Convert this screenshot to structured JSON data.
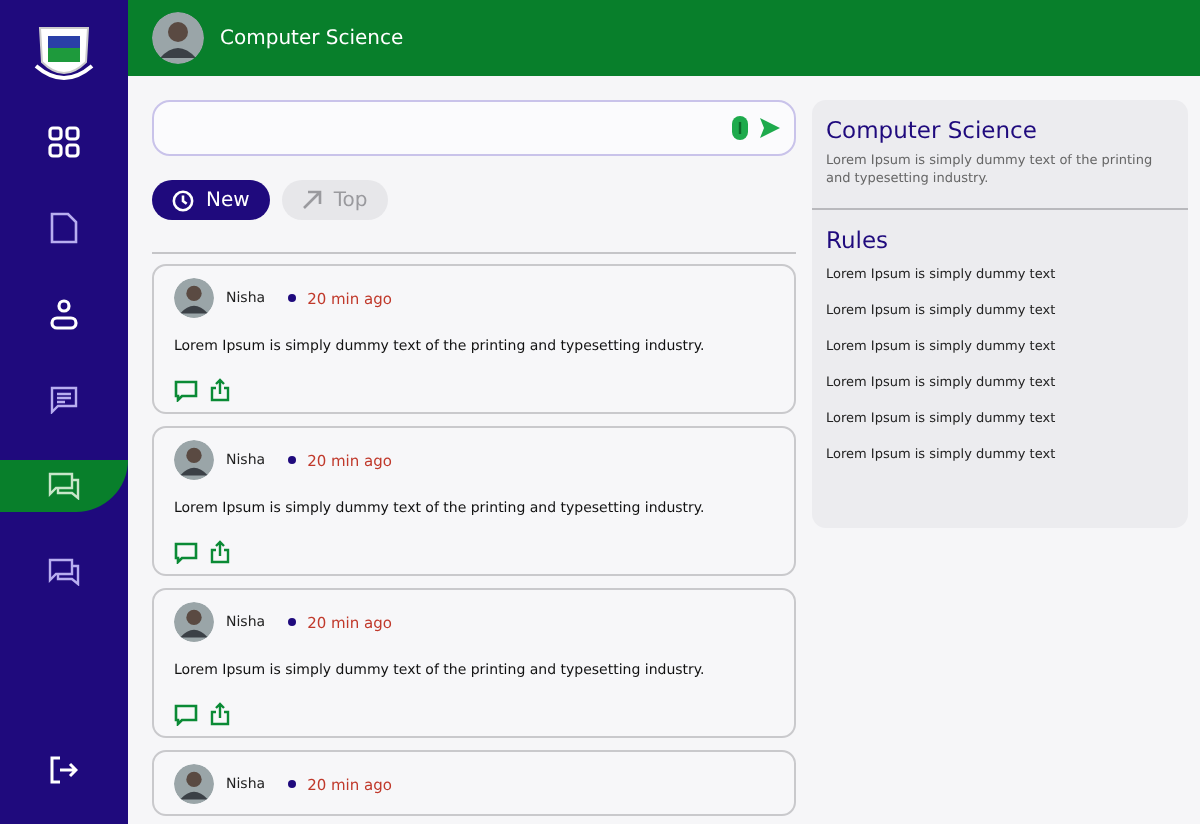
{
  "sidebar": {
    "items": [
      {
        "kind": "grid",
        "selected": false
      },
      {
        "kind": "document",
        "selected": false
      },
      {
        "kind": "user",
        "selected": false
      },
      {
        "kind": "message",
        "selected": false
      },
      {
        "kind": "chat",
        "selected": true
      },
      {
        "kind": "chat",
        "selected": false
      }
    ]
  },
  "header": {
    "title": "Computer Science"
  },
  "sort_tabs": [
    {
      "label": "New",
      "kind": "clock",
      "selected": true
    },
    {
      "label": "Top",
      "kind": "trend",
      "selected": false
    }
  ],
  "posts": [
    {
      "author": "Nisha",
      "time": "20 min ago",
      "text": "Lorem Ipsum is simply dummy text of the printing and typesetting industry."
    },
    {
      "author": "Nisha",
      "time": "20 min ago",
      "text": "Lorem Ipsum is simply dummy text of the printing and typesetting industry."
    },
    {
      "author": "Nisha",
      "time": "20 min ago",
      "text": "Lorem Ipsum is simply dummy text of the printing and typesetting industry."
    },
    {
      "author": "Nisha",
      "time": "20 min ago"
    }
  ],
  "about": {
    "title": "Computer Science",
    "description": "Lorem Ipsum is simply dummy text of the printing and typesetting industry."
  },
  "rules": {
    "title": "Rules",
    "items": [
      "Lorem Ipsum is simply dummy text",
      "Lorem Ipsum is simply dummy text",
      "Lorem Ipsum is simply dummy text",
      "Lorem Ipsum is simply dummy text",
      "Lorem Ipsum is simply dummy text",
      "Lorem Ipsum is simply dummy text"
    ]
  }
}
